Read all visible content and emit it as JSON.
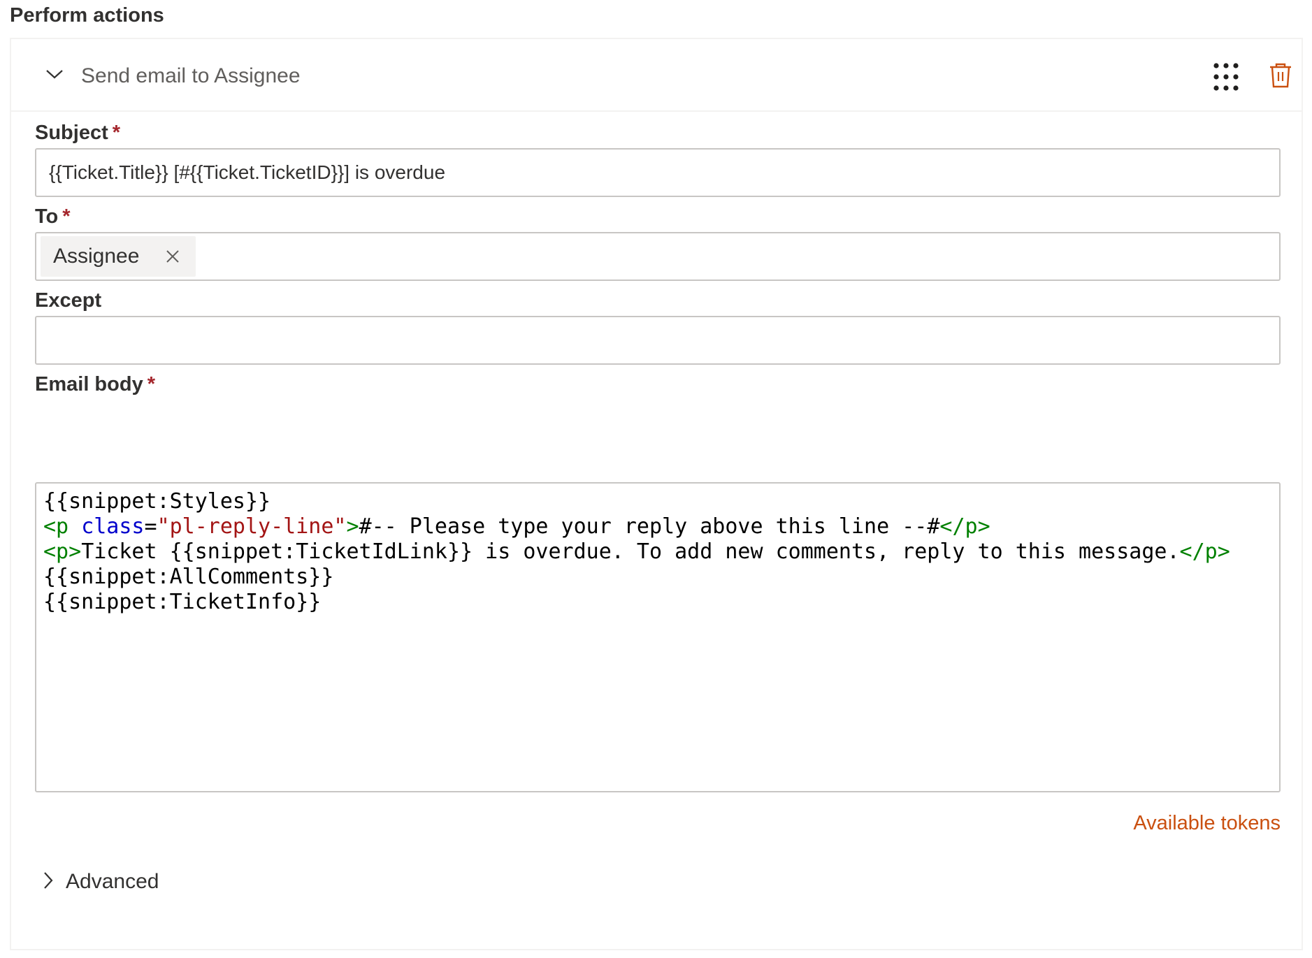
{
  "section": {
    "title": "Perform actions"
  },
  "action": {
    "title": "Send email to Assignee",
    "collapse_icon": "chevron-down-icon",
    "drag_icon": "drag-grid-icon",
    "delete_icon": "trash-icon",
    "delete_color": "#ca5010"
  },
  "fields": {
    "subject": {
      "label": "Subject",
      "required_mark": "*",
      "value": "{{Ticket.Title}} [#{{Ticket.TicketID}}] is overdue"
    },
    "to": {
      "label": "To",
      "required_mark": "*",
      "tags": [
        "Assignee"
      ]
    },
    "except": {
      "label": "Except",
      "value": ""
    },
    "email_body": {
      "label": "Email body",
      "required_mark": "*",
      "lines": [
        [
          {
            "t": "text",
            "v": "{{snippet:Styles}}"
          }
        ],
        [
          {
            "t": "tag",
            "v": "<p"
          },
          {
            "t": "text",
            "v": " "
          },
          {
            "t": "attr",
            "v": "class"
          },
          {
            "t": "text",
            "v": "="
          },
          {
            "t": "str",
            "v": "\"pl-reply-line\""
          },
          {
            "t": "tag",
            "v": ">"
          },
          {
            "t": "text",
            "v": "#-- Please type your reply above this line --#"
          },
          {
            "t": "tag",
            "v": "</p>"
          }
        ],
        [
          {
            "t": "tag",
            "v": "<p>"
          },
          {
            "t": "text",
            "v": "Ticket {{snippet:TicketIdLink}} is overdue. To add new comments, reply to this message."
          },
          {
            "t": "tag",
            "v": "</p>"
          }
        ],
        [
          {
            "t": "text",
            "v": "{{snippet:AllComments}}"
          }
        ],
        [
          {
            "t": "text",
            "v": "{{snippet:TicketInfo}}"
          }
        ]
      ]
    }
  },
  "links": {
    "available_tokens": "Available tokens"
  },
  "advanced": {
    "label": "Advanced",
    "icon": "chevron-right-icon"
  },
  "colors": {
    "accent": "#ca5010",
    "required": "#a4262c",
    "code_tag": "#008000",
    "code_attr": "#0000cc",
    "code_string": "#a31515"
  }
}
